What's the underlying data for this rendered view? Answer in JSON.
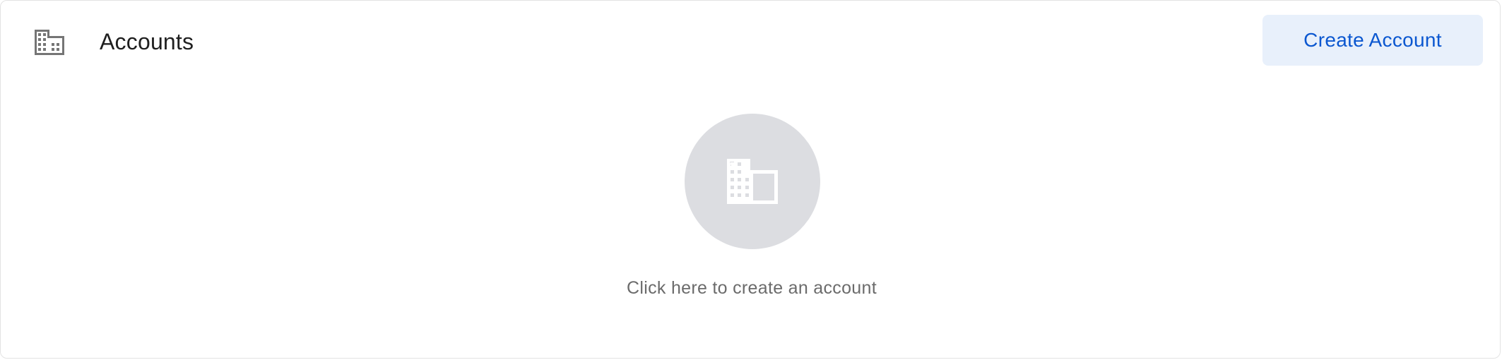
{
  "header": {
    "icon": "building-icon",
    "title": "Accounts",
    "create_button_label": "Create Account"
  },
  "empty_state": {
    "icon": "building-icon",
    "message": "Click here to create an account"
  },
  "colors": {
    "accent": "#0b57d0",
    "button_bg": "#e8f0fb",
    "empty_circle": "#dcdde1",
    "header_icon": "#757575",
    "muted_text": "#6b6b6b"
  }
}
